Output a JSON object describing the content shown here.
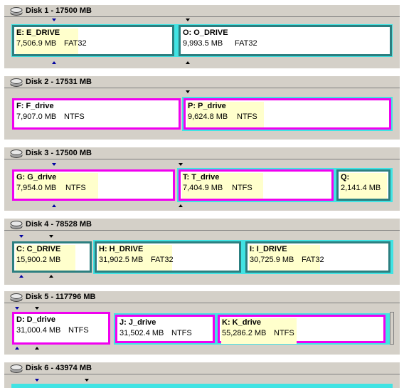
{
  "disks": [
    {
      "title": "Disk 1 - 17500 MB",
      "partitions": [
        {
          "name": "E:  E_DRIVE",
          "size": "7,506.9 MB",
          "fs": "FAT32"
        },
        {
          "name": "O:  O_DRIVE",
          "size": "9,993.5 MB",
          "fs": "FAT32"
        }
      ]
    },
    {
      "title": "Disk 2 - 17531 MB",
      "partitions": [
        {
          "name": "F:  F_drive",
          "size": "7,907.0 MB",
          "fs": "NTFS"
        },
        {
          "name": "P:  P_drive",
          "size": "9,624.8 MB",
          "fs": "NTFS"
        }
      ]
    },
    {
      "title": "Disk 3 - 17500 MB",
      "partitions": [
        {
          "name": "G:  G_drive",
          "size": "7,954.0 MB",
          "fs": "NTFS"
        },
        {
          "name": "T:  T_drive",
          "size": "7,404.9 MB",
          "fs": "NTFS"
        },
        {
          "name": "Q:",
          "size": "2,141.4 MB",
          "fs": ""
        }
      ]
    },
    {
      "title": "Disk 4 - 78528 MB",
      "partitions": [
        {
          "name": "C:  C_DRIVE",
          "size": "15,900.2 MB",
          "fs": ""
        },
        {
          "name": "H:  H_DRIVE",
          "size": "31,902.5 MB",
          "fs": "FAT32"
        },
        {
          "name": "I:  I_DRIVE",
          "size": "30,725.9 MB",
          "fs": "FAT32"
        }
      ]
    },
    {
      "title": "Disk 5 - 117796 MB",
      "partitions": [
        {
          "name": "D:  D_drive",
          "size": "31,000.4 MB",
          "fs": "NTFS"
        },
        {
          "name": "J:  J_drive",
          "size": "31,502.4 MB",
          "fs": "NTFS"
        },
        {
          "name": "K:  K_drive",
          "size": "55,286.2 MB",
          "fs": "NTFS"
        }
      ]
    },
    {
      "title": "Disk 6 - 43974 MB",
      "partitions": []
    }
  ],
  "colors": {
    "primary_border": "#f000f0",
    "logical_border": "#2c7f80",
    "extended_fill": "#41e3e3",
    "info_fill": "#ffffcc",
    "panel_bg": "#d4d0c8"
  }
}
